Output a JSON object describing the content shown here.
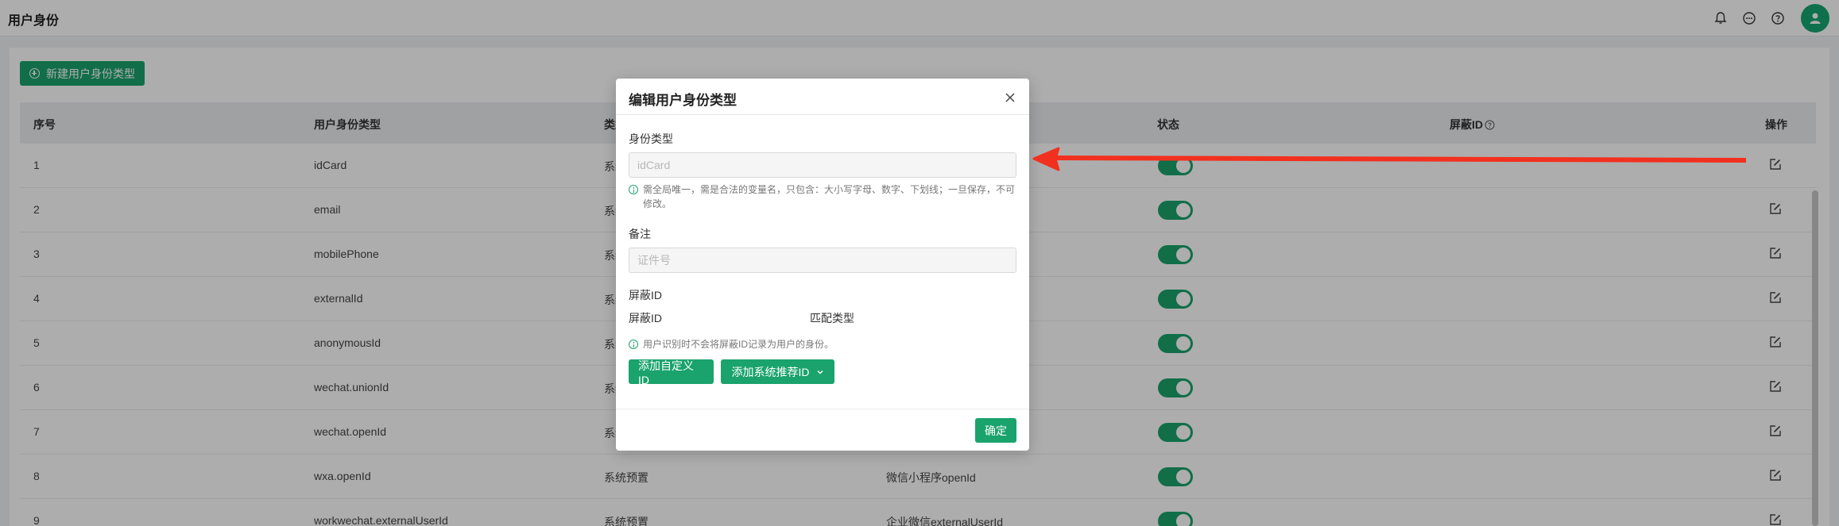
{
  "header": {
    "title": "用户身份"
  },
  "toolbar": {
    "new_label": "新建用户身份类型"
  },
  "table": {
    "columns": [
      "序号",
      "用户身份类型",
      "类型",
      "状态",
      "屏蔽ID",
      "操作"
    ],
    "rows": [
      {
        "index": "1",
        "type_name": "idCard",
        "category": "系统",
        "remark": "",
        "enabled": true
      },
      {
        "index": "2",
        "type_name": "email",
        "category": "系统",
        "remark": "",
        "enabled": true
      },
      {
        "index": "3",
        "type_name": "mobilePhone",
        "category": "系统",
        "remark": "",
        "enabled": true
      },
      {
        "index": "4",
        "type_name": "externalId",
        "category": "系统",
        "remark": "",
        "enabled": true
      },
      {
        "index": "5",
        "type_name": "anonymousId",
        "category": "系统",
        "remark": "",
        "enabled": true
      },
      {
        "index": "6",
        "type_name": "wechat.unionId",
        "category": "系统",
        "remark": "",
        "enabled": true
      },
      {
        "index": "7",
        "type_name": "wechat.openId",
        "category": "系统",
        "remark": "",
        "enabled": true
      },
      {
        "index": "8",
        "type_name": "wxa.openId",
        "category": "系统预置",
        "remark": "微信小程序openId",
        "enabled": true
      },
      {
        "index": "9",
        "type_name": "workwechat.externalUserId",
        "category": "系统预置",
        "remark": "企业微信externalUserId",
        "enabled": true
      }
    ]
  },
  "modal": {
    "title": "编辑用户身份类型",
    "identity_label": "身份类型",
    "identity_placeholder": "idCard",
    "identity_hint": "需全局唯一，需是合法的变量名，只包含：大小写字母、数字、下划线；一旦保存，不可修改。",
    "remark_label": "备注",
    "remark_placeholder": "证件号",
    "block_section_label": "屏蔽ID",
    "block_col_id": "屏蔽ID",
    "block_col_match": "匹配类型",
    "block_hint": "用户识别时不会将屏蔽ID记录为用户的身份。",
    "add_custom_label": "添加自定义ID",
    "add_system_label": "添加系统推荐ID",
    "confirm_label": "确定"
  },
  "colors": {
    "accent": "#1aa36c",
    "arrow": "#f2301f"
  }
}
